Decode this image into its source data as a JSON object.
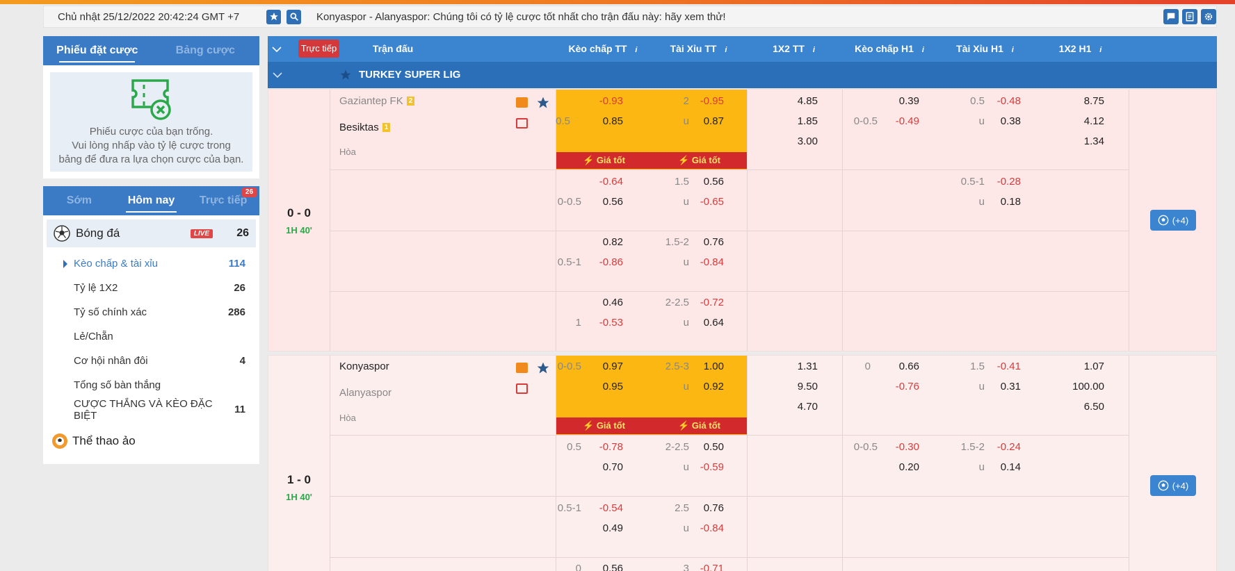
{
  "topbar": {
    "datetime": "Chủ nhật 25/12/2022 20:42:24 GMT +7",
    "marquee": "Konyaspor - Alanyaspor: Chúng tôi có tỷ lệ cược tốt nhất cho trận đấu này: hãy xem thử!"
  },
  "betslip": {
    "tab_active": "Phiếu đặt cược",
    "tab_other": "Bảng cược",
    "empty_line1": "Phiếu cược của bạn trống.",
    "empty_line2": "Vui lòng nhấp vào tỷ lệ cược trong",
    "empty_line3": "bảng để đưa ra lựa chọn cược của bạn."
  },
  "sports": {
    "tabs": [
      "Sớm",
      "Hôm nay",
      "Trực tiếp"
    ],
    "live_count": "26",
    "football": {
      "label": "Bóng đá",
      "live": "LIVE",
      "count": "26"
    },
    "menu": [
      {
        "label": "Kèo chấp & tài xỉu",
        "count": "114"
      },
      {
        "label": "Tỷ lệ 1X2",
        "count": "26"
      },
      {
        "label": "Tỷ số chính xác",
        "count": "286"
      },
      {
        "label": "Lẻ/Chẵn",
        "count": ""
      },
      {
        "label": "Cơ hội nhân đôi",
        "count": "4"
      },
      {
        "label": "Tổng số bàn thắng",
        "count": ""
      },
      {
        "label": "CƯỢC THẮNG VÀ KÈO ĐẶC BIỆT",
        "count": "11"
      }
    ],
    "virtual": "Thể thao ảo"
  },
  "table": {
    "live_btn": "Trực tiếp",
    "headers": [
      "Trận đấu",
      "Kèo chấp TT",
      "Tài Xỉu TT",
      "1X2 TT",
      "Kèo chấp H1",
      "Tài Xỉu H1",
      "1X2 H1"
    ],
    "info": "i",
    "league": "TURKEY SUPER LIG",
    "best_price": "Giá tốt",
    "more": "(+4)",
    "draw": "Hòa"
  },
  "matches": [
    {
      "home": "Gaziantep FK",
      "home_num": "2",
      "away": "Besiktas",
      "away_num": "1",
      "score": "0 - 0",
      "time": "1H 40'",
      "x12": [
        "4.85",
        "1.85",
        "3.00"
      ],
      "x12h1": [
        "8.75",
        "4.12",
        "1.34"
      ],
      "rows": [
        {
          "hcap": [
            "",
            "0.5"
          ],
          "hodds": [
            "-0.93",
            "0.85"
          ],
          "ou": [
            "2",
            "u"
          ],
          "ouodds": [
            "-0.95",
            "0.87"
          ],
          "h1cap": [
            "",
            "0-0.5"
          ],
          "h1odds": [
            "0.39",
            "-0.49"
          ],
          "h1ou": [
            "0.5",
            "u"
          ],
          "h1ouodds": [
            "-0.48",
            "0.38"
          ]
        },
        {
          "hcap": [
            "",
            "0-0.5"
          ],
          "hodds": [
            "-0.64",
            "0.56"
          ],
          "ou": [
            "1.5",
            "u"
          ],
          "ouodds": [
            "0.56",
            "-0.65"
          ],
          "h1cap": [
            "",
            ""
          ],
          "h1odds": [
            "",
            ""
          ],
          "h1ou": [
            "0.5-1",
            "u"
          ],
          "h1ouodds": [
            "-0.28",
            "0.18"
          ]
        },
        {
          "hcap": [
            "",
            "0.5-1"
          ],
          "hodds": [
            "0.82",
            "-0.86"
          ],
          "ou": [
            "1.5-2",
            "u"
          ],
          "ouodds": [
            "0.76",
            "-0.84"
          ],
          "h1cap": [
            "",
            ""
          ],
          "h1odds": [
            "",
            ""
          ],
          "h1ou": [
            "",
            ""
          ],
          "h1ouodds": [
            "",
            ""
          ]
        },
        {
          "hcap": [
            "",
            "1"
          ],
          "hodds": [
            "0.46",
            "-0.53"
          ],
          "ou": [
            "2-2.5",
            "u"
          ],
          "ouodds": [
            "-0.72",
            "0.64"
          ],
          "h1cap": [
            "",
            ""
          ],
          "h1odds": [
            "",
            ""
          ],
          "h1ou": [
            "",
            ""
          ],
          "h1ouodds": [
            "",
            ""
          ]
        }
      ]
    },
    {
      "home": "Konyaspor",
      "home_num": "",
      "away": "Alanyaspor",
      "away_num": "",
      "score": "1 - 0",
      "time": "1H 40'",
      "x12": [
        "1.31",
        "9.50",
        "4.70"
      ],
      "x12h1": [
        "1.07",
        "100.00",
        "6.50"
      ],
      "rows": [
        {
          "hcap": [
            "0-0.5",
            ""
          ],
          "hodds": [
            "0.97",
            "0.95"
          ],
          "ou": [
            "2.5-3",
            "u"
          ],
          "ouodds": [
            "1.00",
            "0.92"
          ],
          "h1cap": [
            "0",
            ""
          ],
          "h1odds": [
            "0.66",
            "-0.76"
          ],
          "h1ou": [
            "1.5",
            "u"
          ],
          "h1ouodds": [
            "-0.41",
            "0.31"
          ]
        },
        {
          "hcap": [
            "0.5",
            ""
          ],
          "hodds": [
            "-0.78",
            "0.70"
          ],
          "ou": [
            "2-2.5",
            "u"
          ],
          "ouodds": [
            "0.50",
            "-0.59"
          ],
          "h1cap": [
            "0-0.5",
            ""
          ],
          "h1odds": [
            "-0.30",
            "0.20"
          ],
          "h1ou": [
            "1.5-2",
            "u"
          ],
          "h1ouodds": [
            "-0.24",
            "0.14"
          ]
        },
        {
          "hcap": [
            "0.5-1",
            ""
          ],
          "hodds": [
            "-0.54",
            "0.49"
          ],
          "ou": [
            "2.5",
            "u"
          ],
          "ouodds": [
            "0.76",
            "-0.84"
          ],
          "h1cap": [
            "",
            ""
          ],
          "h1odds": [
            "",
            ""
          ],
          "h1ou": [
            "",
            ""
          ],
          "h1ouodds": [
            "",
            ""
          ]
        },
        {
          "hcap": [
            "0",
            ""
          ],
          "hodds": [
            "0.56",
            ""
          ],
          "ou": [
            "3",
            ""
          ],
          "ouodds": [
            "-0.71",
            ""
          ],
          "h1cap": [
            "",
            ""
          ],
          "h1odds": [
            "",
            ""
          ],
          "h1ou": [
            "",
            ""
          ],
          "h1ouodds": [
            "",
            ""
          ]
        }
      ]
    }
  ]
}
